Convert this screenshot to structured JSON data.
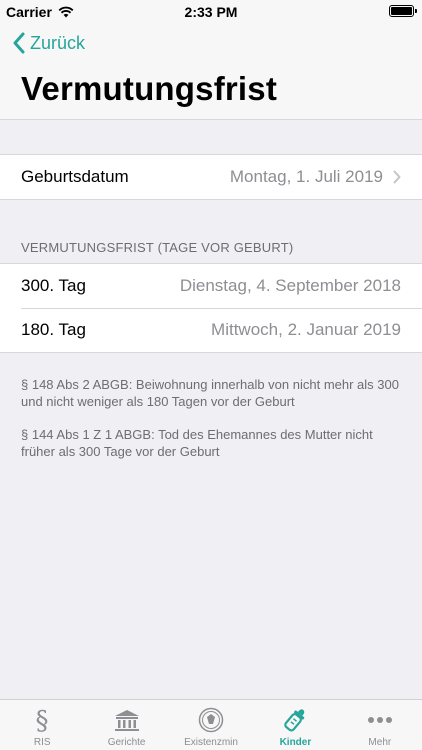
{
  "status": {
    "carrier": "Carrier",
    "time": "2:33 PM"
  },
  "nav": {
    "back_label": "Zurück",
    "title": "Vermutungsfrist"
  },
  "birth": {
    "label": "Geburtsdatum",
    "value": "Montag, 1. Juli 2019"
  },
  "section": {
    "header": "VERMUTUNGSFRIST (TAGE VOR GEBURT)",
    "rows": [
      {
        "label": "300. Tag",
        "value": "Dienstag, 4. September 2018"
      },
      {
        "label": "180. Tag",
        "value": "Mittwoch, 2. Januar 2019"
      }
    ]
  },
  "notes": [
    "§ 148 Abs 2 ABGB: Beiwohnung innerhalb von nicht mehr als 300 und nicht weniger als 180 Tagen vor der Geburt",
    "§ 144 Abs 1 Z 1 ABGB: Tod des Ehemannes des Mutter nicht früher als 300 Tage vor der Geburt"
  ],
  "tabs": [
    {
      "label": "RIS",
      "icon": "paragraph-icon"
    },
    {
      "label": "Gerichte",
      "icon": "courthouse-icon"
    },
    {
      "label": "Existenzmin",
      "icon": "coin-icon"
    },
    {
      "label": "Kinder",
      "icon": "baby-bottle-icon",
      "active": true
    },
    {
      "label": "Mehr",
      "icon": "more-icon"
    }
  ],
  "colors": {
    "accent": "#26a69a",
    "secondary_text": "#8e8e93",
    "background": "#efeff4"
  }
}
